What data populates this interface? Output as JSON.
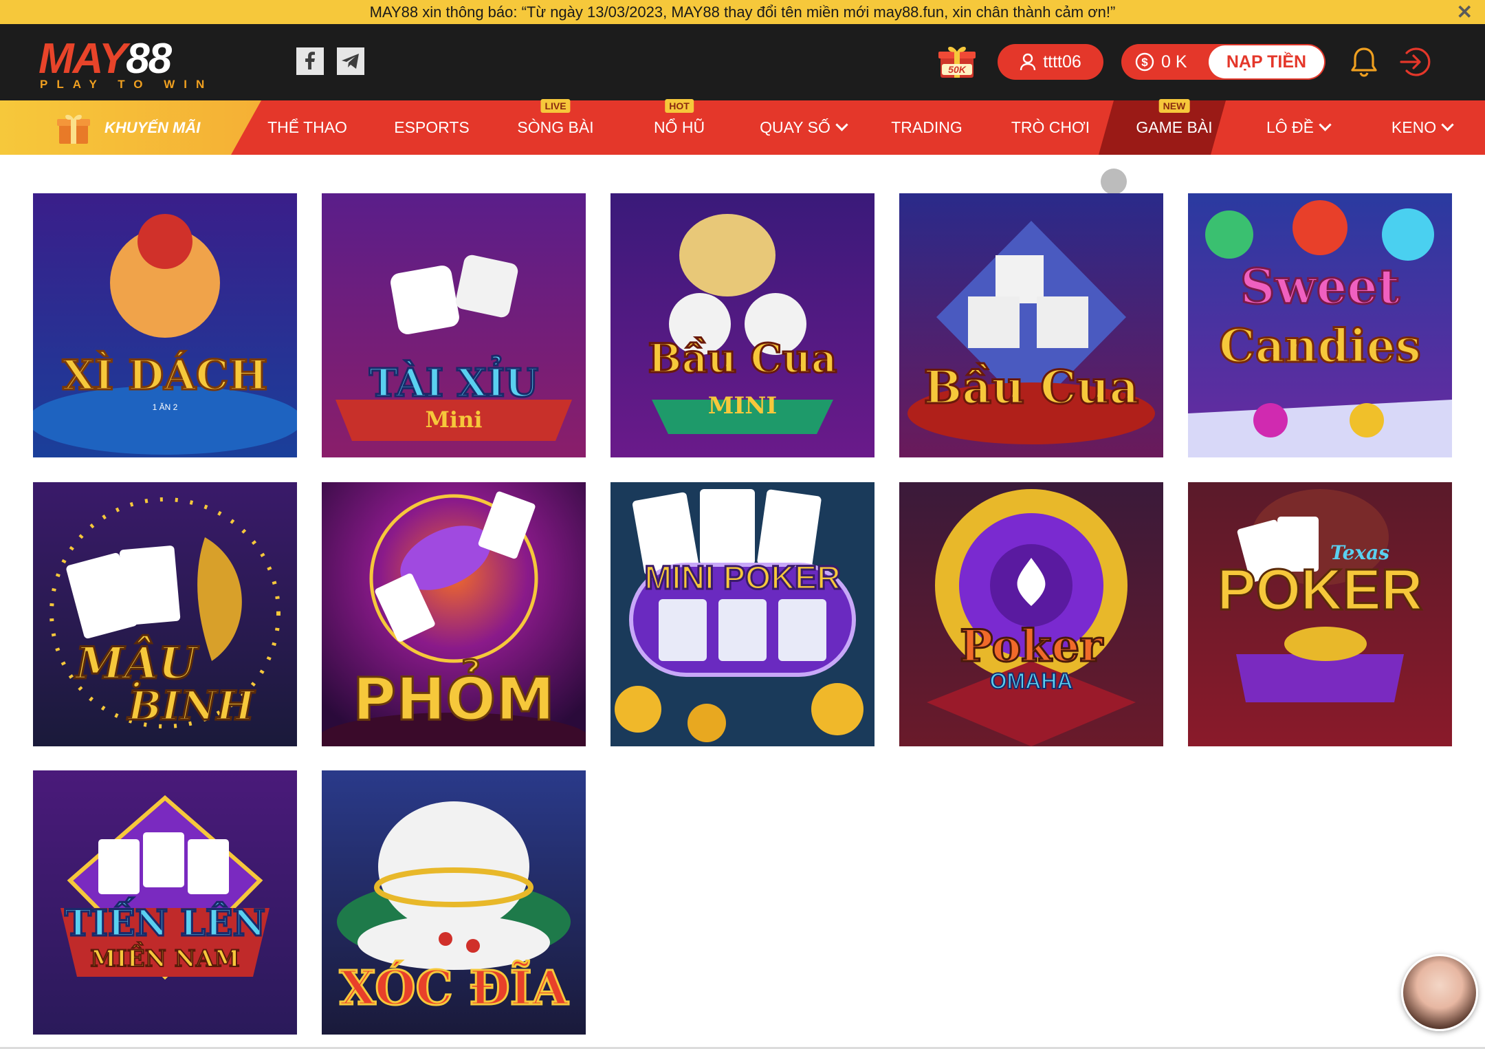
{
  "notice": {
    "text": "MAY88 xin thông báo: “Từ ngày 13/03/2023, MAY88 thay đổi tên miền mới may88.fun, xin chân thành cảm ơn!”",
    "close_icon": "close-icon"
  },
  "header": {
    "logo": {
      "brand_a": "MAY",
      "brand_b": "88",
      "tagline": "PLAY TO WIN"
    },
    "social": [
      "facebook-icon",
      "telegram-icon"
    ],
    "gift_badge": "50K",
    "username": "tttt06",
    "balance": "0 K",
    "deposit_label": "NẠP TIỀN"
  },
  "nav": {
    "promo_label": "KHUYẾN MÃI",
    "items": [
      {
        "label": "THỂ THAO",
        "badge": ""
      },
      {
        "label": "ESPORTS",
        "badge": ""
      },
      {
        "label": "SÒNG BÀI",
        "badge": "LIVE"
      },
      {
        "label": "NỔ HŨ",
        "badge": "HOT"
      },
      {
        "label": "QUAY SỐ",
        "badge": "",
        "dropdown": true
      },
      {
        "label": "TRADING",
        "badge": ""
      },
      {
        "label": "TRÒ CHƠI",
        "badge": ""
      },
      {
        "label": "GAME BÀI",
        "badge": "NEW",
        "active": true
      },
      {
        "label": "LÔ ĐỀ",
        "badge": "",
        "dropdown": true
      },
      {
        "label": "KENO",
        "badge": "",
        "dropdown": true
      }
    ]
  },
  "games": [
    {
      "title": "XÌ DÁCH",
      "subtitle": "1 ĂN 2"
    },
    {
      "title": "TÀI XỈU",
      "subtitle": "Mini"
    },
    {
      "title": "Bầu Cua",
      "subtitle": "MINI"
    },
    {
      "title": "Bầu Cua",
      "subtitle": ""
    },
    {
      "title": "Sweet",
      "subtitle": "Candies"
    },
    {
      "title": "MẬU",
      "subtitle": "BINH"
    },
    {
      "title": "PHỎM",
      "subtitle": ""
    },
    {
      "title": "MINI POKER",
      "subtitle": ""
    },
    {
      "title": "Poker",
      "subtitle": "OMAHA"
    },
    {
      "title": "POKER",
      "subtitle": "Texas"
    },
    {
      "title": "TIẾN LÊN",
      "subtitle": "MIỀN NAM"
    },
    {
      "title": "XÓC ĐĨA",
      "subtitle": ""
    }
  ],
  "colors": {
    "accent": "#e4372a",
    "notice": "#f6c83b",
    "header": "#1c1c1c",
    "active": "#9a1a16"
  }
}
